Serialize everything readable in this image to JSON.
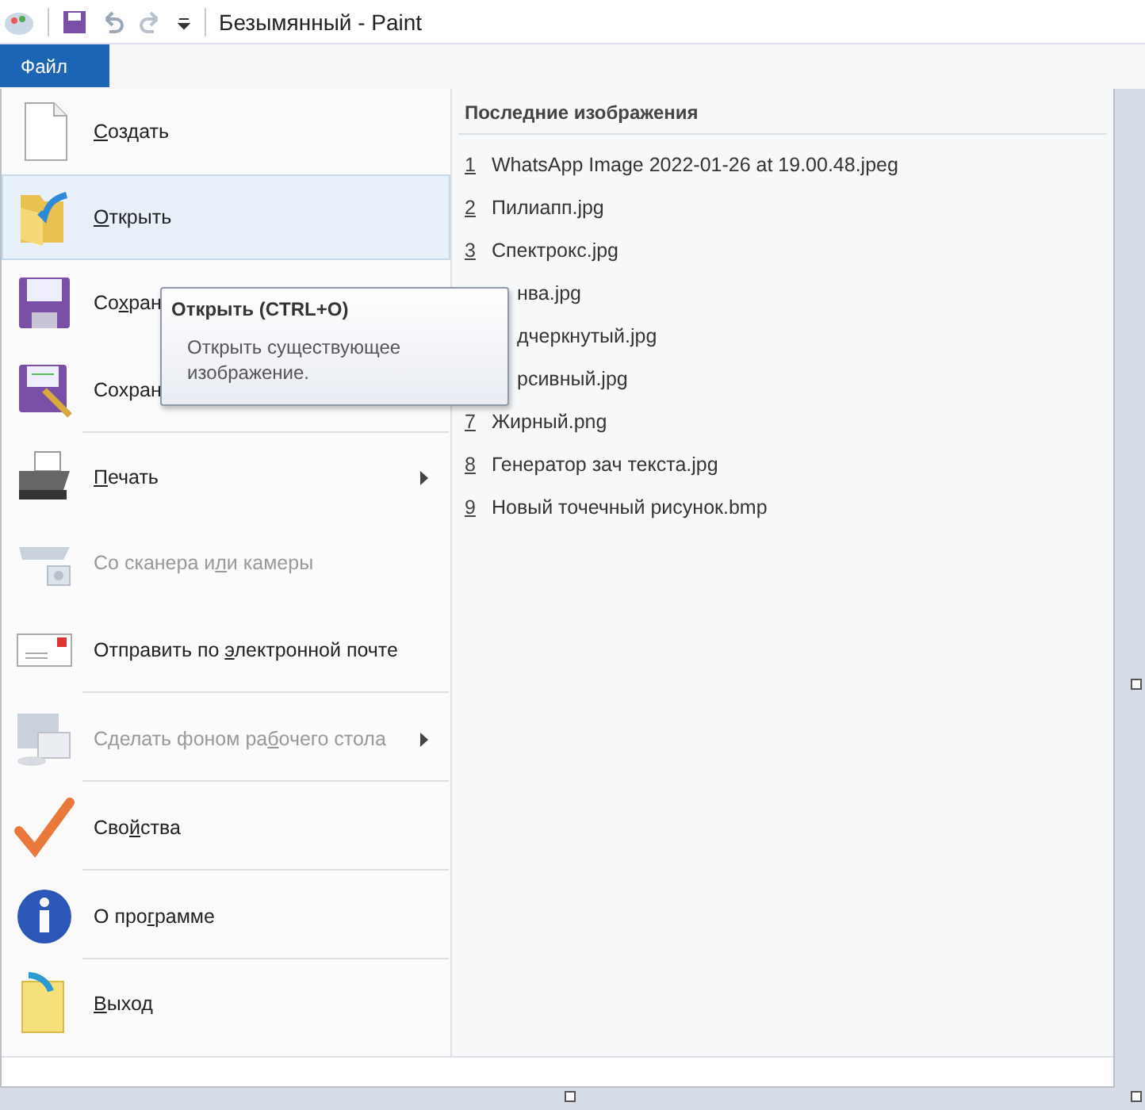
{
  "window": {
    "title": "Безымянный - Paint"
  },
  "file_tab": {
    "label": "Файл",
    "selected": true
  },
  "menu_items": [
    {
      "kind": "new",
      "key": "С",
      "post": "оздать",
      "selected": false,
      "disabled": false,
      "submenu": false,
      "separator_after": false
    },
    {
      "kind": "open",
      "key": "О",
      "post": "ткрыть",
      "selected": true,
      "disabled": false,
      "submenu": false,
      "separator_after": false
    },
    {
      "kind": "save",
      "pre": "Со",
      "key": "х",
      "post": "ран",
      "selected": false,
      "disabled": false,
      "separator_after": false
    },
    {
      "kind": "saveas",
      "pre": "Сохран",
      "selected": false,
      "disabled": false,
      "separator_after": true
    },
    {
      "kind": "print",
      "key": "П",
      "post": "ечать",
      "selected": false,
      "disabled": false,
      "submenu": true,
      "separator_after": false
    },
    {
      "kind": "scanner",
      "pre": "Со сканера и",
      "key": "л",
      "post": "и камеры",
      "selected": false,
      "disabled": true,
      "submenu": false,
      "separator_after": false
    },
    {
      "kind": "email",
      "pre": "Отправить по ",
      "key": "э",
      "post": "лектронной почте",
      "selected": false,
      "disabled": false,
      "submenu": false,
      "separator_after": true
    },
    {
      "kind": "desktop",
      "pre": "Сделать фоном ра",
      "key": "б",
      "post": "очего стола",
      "selected": false,
      "disabled": true,
      "submenu": true,
      "separator_after": true
    },
    {
      "kind": "properties",
      "pre": "Сво",
      "key": "й",
      "post": "ства",
      "selected": false,
      "disabled": false,
      "submenu": false,
      "separator_after": true
    },
    {
      "kind": "about",
      "pre": "О про",
      "key": "г",
      "post": "рамме",
      "selected": false,
      "disabled": false,
      "submenu": false,
      "separator_after": true
    },
    {
      "kind": "exit",
      "key": "В",
      "post": "ыход",
      "selected": false,
      "disabled": false,
      "submenu": false,
      "separator_after": false
    }
  ],
  "recent": {
    "title": "Последние изображения",
    "items": [
      {
        "number": "1",
        "name": "WhatsApp Image 2022-01-26 at 19.00.48.jpeg"
      },
      {
        "number": "2",
        "name": "Пилиапп.jpg"
      },
      {
        "number": "3",
        "name": "Спектрокс.jpg"
      },
      {
        "name": "нва.jpg"
      },
      {
        "name": "дчеркнутый.jpg"
      },
      {
        "name": "рсивный.jpg"
      },
      {
        "number": "7",
        "name": "Жирный.png"
      },
      {
        "number": "8",
        "name": "Генератор зач текста.jpg"
      },
      {
        "number": "9",
        "name": "Новый точечный рисунок.bmp"
      }
    ]
  },
  "tooltip": {
    "title": "Открыть (CTRL+O)",
    "text": "Открыть существующее изображение."
  }
}
